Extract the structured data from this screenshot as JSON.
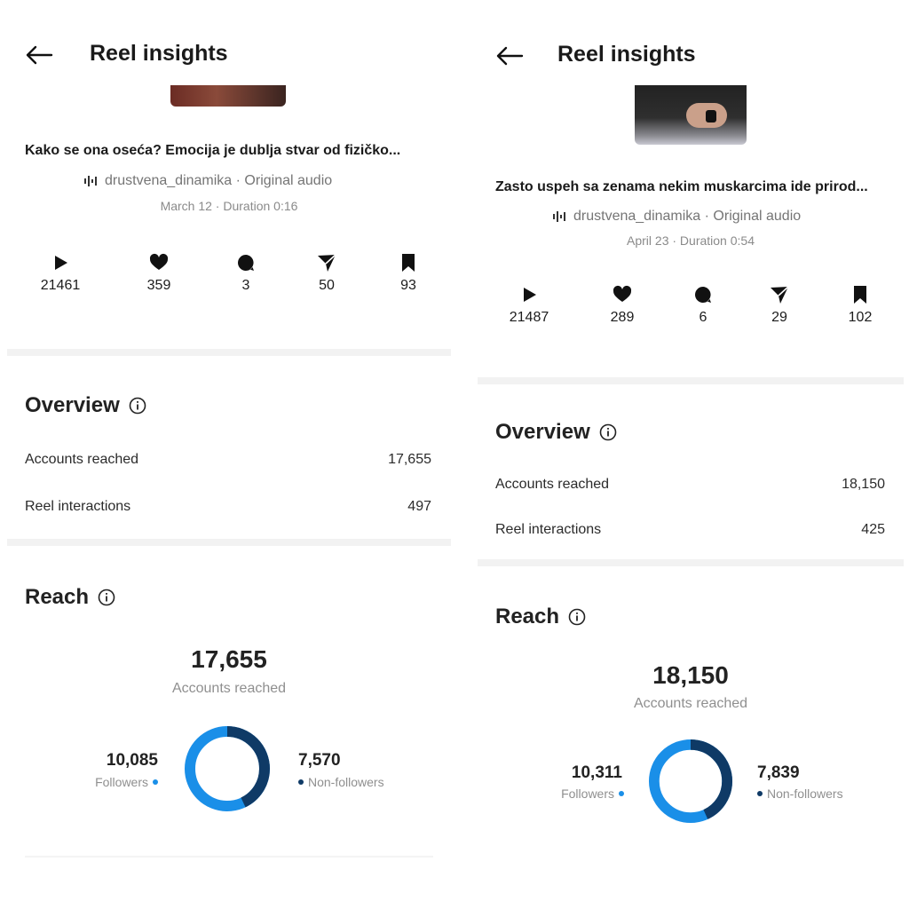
{
  "colors": {
    "followers": "#1a8fe8",
    "non_followers": "#0f3a66"
  },
  "icons": [
    "back-arrow-icon",
    "play-icon",
    "heart-icon",
    "comment-icon",
    "send-icon",
    "bookmark-icon",
    "audio-waveform-icon",
    "info-icon"
  ],
  "panels": [
    {
      "header": {
        "title": "Reel insights"
      },
      "reel": {
        "title": "Kako se ona oseća? Emocija je dublja stvar od fizičko...",
        "audio": "drustvena_dinamika · Original audio",
        "meta": "March 12 · Duration 0:16"
      },
      "stats": {
        "plays": "21461",
        "likes": "359",
        "comments": "3",
        "shares": "50",
        "saves": "93"
      },
      "overview": {
        "title": "Overview",
        "accounts_reached_label": "Accounts reached",
        "accounts_reached_value": "17,655",
        "reel_interactions_label": "Reel interactions",
        "reel_interactions_value": "497"
      },
      "reach": {
        "title": "Reach",
        "total": "17,655",
        "total_label": "Accounts reached",
        "followers": "10,085",
        "followers_label": "Followers",
        "non_followers": "7,570",
        "non_followers_label": "Non-followers",
        "followers_value": 10085,
        "non_followers_value": 7570
      }
    },
    {
      "header": {
        "title": "Reel insights"
      },
      "reel": {
        "title": "Zasto uspeh sa zenama nekim muskarcima ide prirod...",
        "audio": "drustvena_dinamika · Original audio",
        "meta": "April 23 · Duration 0:54"
      },
      "stats": {
        "plays": "21487",
        "likes": "289",
        "comments": "6",
        "shares": "29",
        "saves": "102"
      },
      "overview": {
        "title": "Overview",
        "accounts_reached_label": "Accounts reached",
        "accounts_reached_value": "18,150",
        "reel_interactions_label": "Reel interactions",
        "reel_interactions_value": "425"
      },
      "reach": {
        "title": "Reach",
        "total": "18,150",
        "total_label": "Accounts reached",
        "followers": "10,311",
        "followers_label": "Followers",
        "non_followers": "7,839",
        "non_followers_label": "Non-followers",
        "followers_value": 10311,
        "non_followers_value": 7839
      }
    }
  ]
}
